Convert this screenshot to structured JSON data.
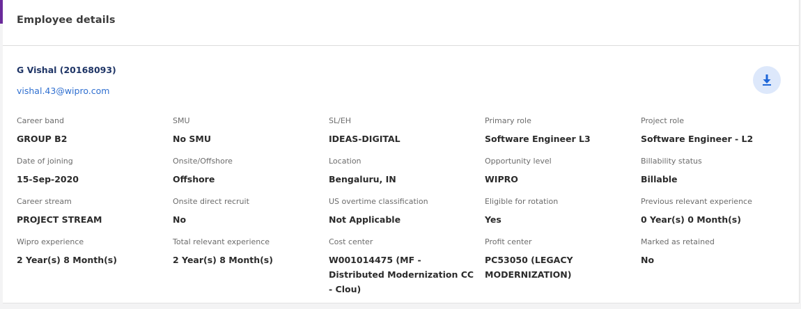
{
  "card": {
    "title": "Employee details"
  },
  "employee": {
    "name": "G Vishal (20168093)",
    "email": "vishal.43@wipro.com"
  },
  "icons": {
    "download": "download-icon"
  },
  "colors": {
    "accent": "#6a2a9a",
    "name": "#1f3566",
    "link": "#2f6fd0",
    "download_bg": "#dde8fb",
    "download_icon": "#1e66d8"
  },
  "fields": [
    [
      {
        "label": "Career band",
        "value": "GROUP B2"
      },
      {
        "label": "SMU",
        "value": "No SMU"
      },
      {
        "label": "SL/EH",
        "value": "IDEAS-DIGITAL"
      },
      {
        "label": "Primary role",
        "value": "Software Engineer L3"
      },
      {
        "label": "Project role",
        "value": "Software Engineer - L2"
      }
    ],
    [
      {
        "label": "Date of joining",
        "value": "15-Sep-2020"
      },
      {
        "label": "Onsite/Offshore",
        "value": "Offshore"
      },
      {
        "label": "Location",
        "value": "Bengaluru, IN"
      },
      {
        "label": "Opportunity level",
        "value": "WIPRO"
      },
      {
        "label": "Billability status",
        "value": "Billable"
      }
    ],
    [
      {
        "label": "Career stream",
        "value": "PROJECT STREAM"
      },
      {
        "label": "Onsite direct recruit",
        "value": "No"
      },
      {
        "label": "US overtime classification",
        "value": "Not Applicable"
      },
      {
        "label": "Eligible for rotation",
        "value": "Yes"
      },
      {
        "label": "Previous relevant experience",
        "value": "0 Year(s) 0 Month(s)"
      }
    ],
    [
      {
        "label": "Wipro experience",
        "value": "2 Year(s) 8 Month(s)"
      },
      {
        "label": "Total relevant experience",
        "value": "2 Year(s) 8 Month(s)"
      },
      {
        "label": "Cost center",
        "value": "W001014475 (MF - Distributed Modernization CC - Clou)"
      },
      {
        "label": "Profit center",
        "value": "PC53050 (LEGACY MODERNIZATION)"
      },
      {
        "label": "Marked as retained",
        "value": "No"
      }
    ]
  ]
}
